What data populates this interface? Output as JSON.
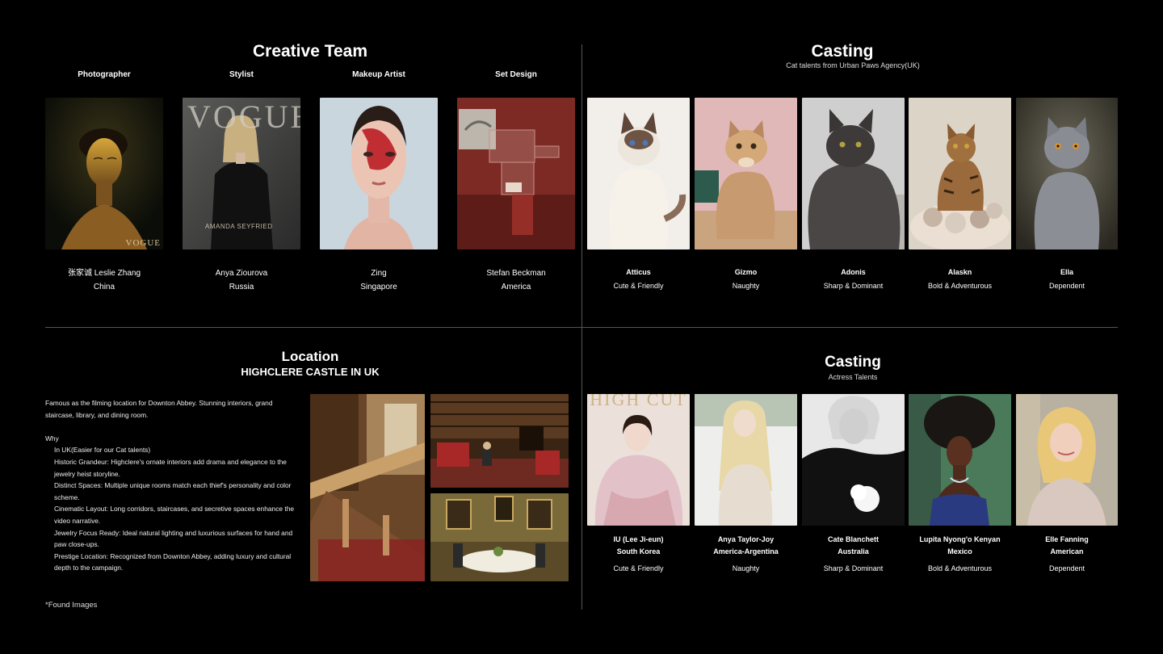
{
  "creative_team": {
    "title": "Creative Team",
    "members": [
      {
        "role": "Photographer",
        "name": "张家诚 Leslie Zhang",
        "country": "China",
        "overlay": "VOGUE"
      },
      {
        "role": "Stylist",
        "name": "Anya Ziourova",
        "country": "Russia",
        "overlay": "VOGUE",
        "overlay2": "AMANDA SEYFRIED"
      },
      {
        "role": "Makeup Artist",
        "name": "Zing",
        "country": "Singapore"
      },
      {
        "role": "Set Design",
        "name": "Stefan Beckman",
        "country": "America"
      }
    ]
  },
  "casting_cats": {
    "title": "Casting",
    "subtitle": "Cat talents from Urban Paws Agency(UK)",
    "cats": [
      {
        "name": "Atticus",
        "trait": "Cute & Friendly"
      },
      {
        "name": "Gizmo",
        "trait": "Naughty"
      },
      {
        "name": "Adonis",
        "trait": "Sharp & Dominant"
      },
      {
        "name": "Alaskn",
        "trait": "Bold & Adventurous"
      },
      {
        "name": "Ella",
        "trait": "Dependent"
      }
    ]
  },
  "location": {
    "title": "Location",
    "subtitle": "HIGHCLERE CASTLE IN UK",
    "intro": "Famous as the filming location for Downton Abbey. Stunning interiors, grand staircase, library, and dining room.",
    "why_label": "Why",
    "reasons": [
      "In UK(Easier for our Cat talents)",
      "Historic Grandeur: Highclere's ornate interiors add drama and elegance to the jewelry heist storyline.",
      "Distinct Spaces: Multiple unique rooms match each thief's personality and color scheme.",
      "Cinematic Layout: Long corridors, staircases, and secretive spaces enhance the video narrative.",
      "Jewelry Focus Ready: Ideal natural lighting and luxurious surfaces for hand and paw close-ups.",
      "Prestige Location: Recognized from Downton Abbey, adding luxury and cultural depth to the campaign."
    ],
    "footnote": "*Found Images"
  },
  "casting_actress": {
    "title": "Casting",
    "subtitle": "Actress Talents",
    "actresses": [
      {
        "name": "IU (Lee Ji-eun)",
        "country": "South Korea",
        "trait": "Cute & Friendly",
        "overlay": "HIGH CUT"
      },
      {
        "name": "Anya Taylor-Joy",
        "country": "America-Argentina",
        "trait": "Naughty"
      },
      {
        "name": "Cate Blanchett",
        "country": "Australia",
        "trait": "Sharp & Dominant"
      },
      {
        "name": "Lupita Nyong'o Kenyan",
        "country": "Mexico",
        "trait": "Bold & Adventurous"
      },
      {
        "name": "Elle Fanning",
        "country": "American",
        "trait": "Dependent"
      }
    ]
  }
}
